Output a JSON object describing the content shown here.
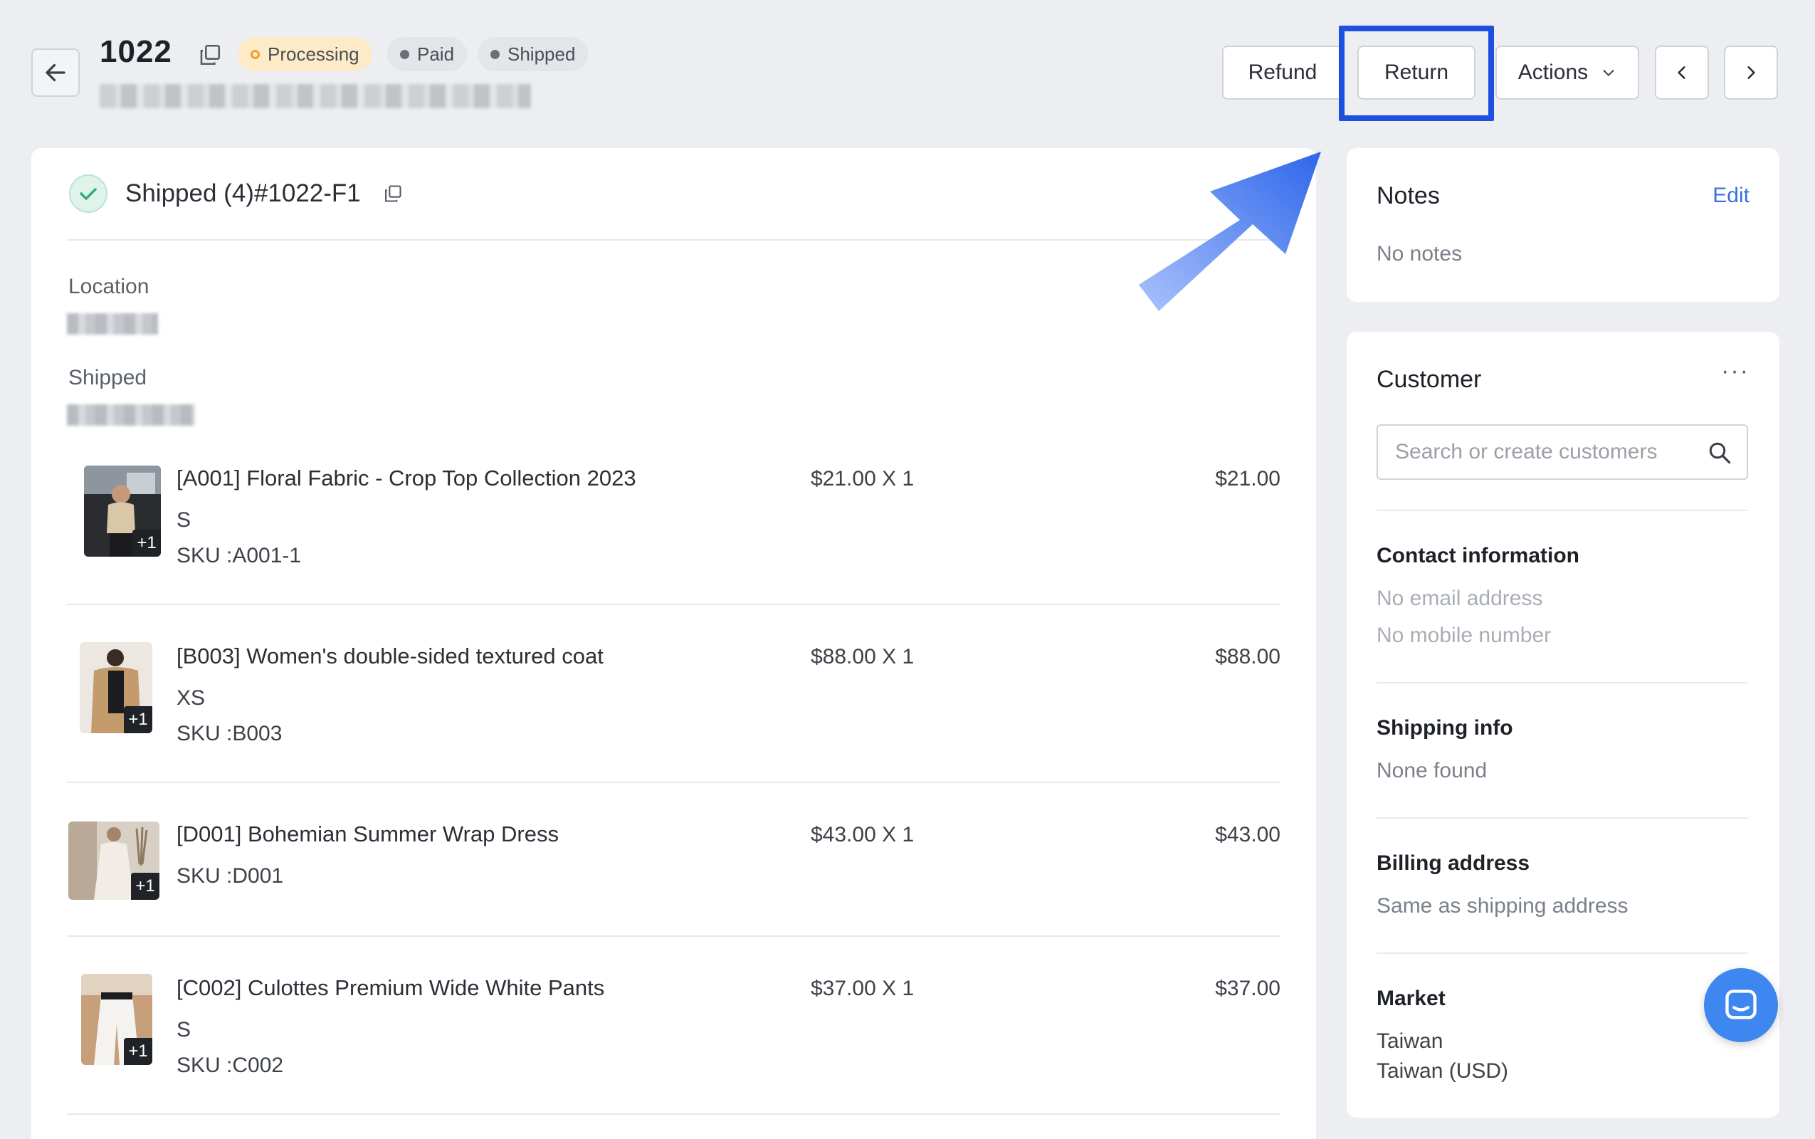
{
  "header": {
    "order_number": "1022",
    "badges": {
      "processing": "Processing",
      "paid": "Paid",
      "shipped": "Shipped"
    },
    "buttons": {
      "refund": "Refund",
      "return": "Return",
      "actions": "Actions"
    }
  },
  "fulfillment": {
    "title": "Shipped (4)#1022-F1",
    "location_label": "Location",
    "shipped_label": "Shipped"
  },
  "items": [
    {
      "name": "[A001] Floral Fabric - Crop Top Collection 2023",
      "variant": "S",
      "sku": "SKU :A001-1",
      "price": "$21.00 X 1",
      "total": "$21.00",
      "extra": "+1"
    },
    {
      "name": "[B003] Women's double-sided textured coat",
      "variant": "XS",
      "sku": "SKU :B003",
      "price": "$88.00 X 1",
      "total": "$88.00",
      "extra": "+1"
    },
    {
      "name": "[D001] Bohemian Summer Wrap Dress",
      "variant": "",
      "sku": "SKU :D001",
      "price": "$43.00 X 1",
      "total": "$43.00",
      "extra": "+1"
    },
    {
      "name": "[C002] Culottes Premium Wide White Pants",
      "variant": "S",
      "sku": "SKU :C002",
      "price": "$37.00 X 1",
      "total": "$37.00",
      "extra": "+1"
    }
  ],
  "notes": {
    "title": "Notes",
    "edit": "Edit",
    "empty": "No notes"
  },
  "customer": {
    "title": "Customer",
    "more": "···",
    "search_placeholder": "Search or create customers",
    "contact_title": "Contact information",
    "no_email": "No email address",
    "no_mobile": "No mobile number",
    "shipping_title": "Shipping info",
    "shipping_value": "None found",
    "billing_title": "Billing address",
    "billing_value": "Same as shipping address",
    "market_title": "Market",
    "market_value": "Taiwan",
    "market_currency": "Taiwan (USD)"
  },
  "colors": {
    "highlight": "#1d4fe0",
    "link": "#3b6fe0",
    "processing_bg": "#fdebc8",
    "processing_dot": "#f0a020",
    "fulfilled_check": "#2fae7a",
    "chat_fab": "#3f87f0"
  }
}
